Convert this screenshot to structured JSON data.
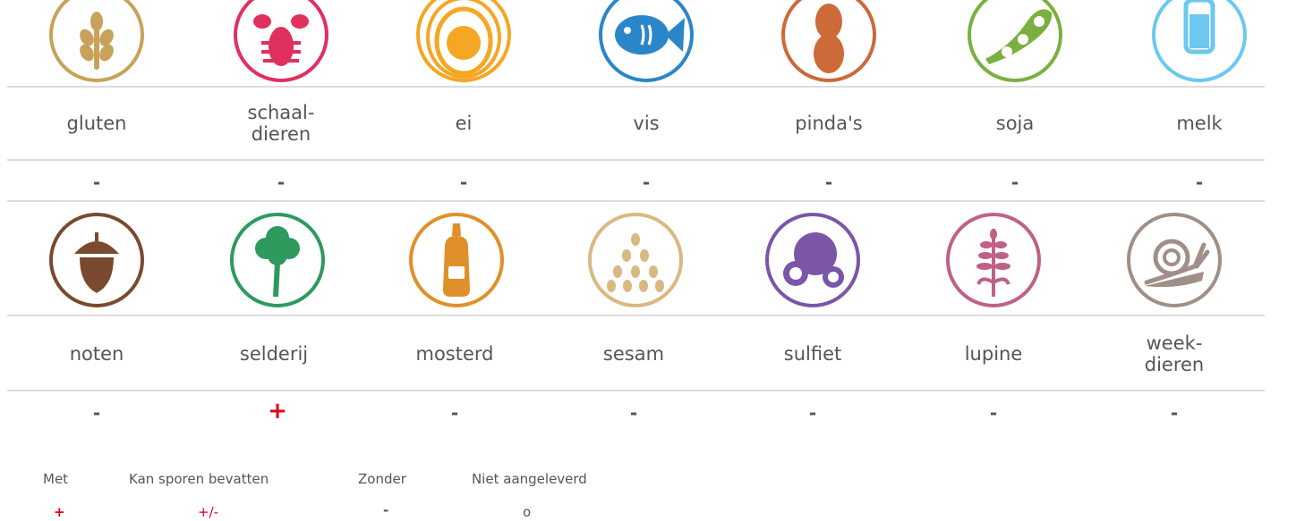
{
  "allergens_top": [
    {
      "label": "gluten",
      "value": "-",
      "color": "#c8a25a",
      "icon": "wheat-icon"
    },
    {
      "label": "schaal-\ndieren",
      "value": "-",
      "color": "#e0305e",
      "icon": "lobster-icon"
    },
    {
      "label": "ei",
      "value": "-",
      "color": "#f5a623",
      "icon": "egg-icon"
    },
    {
      "label": "vis",
      "value": "-",
      "color": "#2a86c8",
      "icon": "fish-icon"
    },
    {
      "label": "pinda's",
      "value": "-",
      "color": "#cc6a3a",
      "icon": "peanut-icon"
    },
    {
      "label": "soja",
      "value": "-",
      "color": "#7ab040",
      "icon": "soy-icon"
    },
    {
      "label": "melk",
      "value": "-",
      "color": "#6cc8f0",
      "icon": "milk-icon"
    }
  ],
  "allergens_bottom": [
    {
      "label": "noten",
      "value": "-",
      "color": "#7a4a2e",
      "icon": "acorn-icon"
    },
    {
      "label": "selderij",
      "value": "+",
      "color": "#2e9a5e",
      "icon": "celery-icon"
    },
    {
      "label": "mosterd",
      "value": "-",
      "color": "#e0902a",
      "icon": "mustard-icon"
    },
    {
      "label": "sesam",
      "value": "-",
      "color": "#d9b884",
      "icon": "sesame-icon"
    },
    {
      "label": "sulfiet",
      "value": "-",
      "color": "#7a55a8",
      "icon": "sulfite-icon"
    },
    {
      "label": "lupine",
      "value": "-",
      "color": "#c06088",
      "icon": "lupine-icon"
    },
    {
      "label": "week-\ndieren",
      "value": "-",
      "color": "#a08f86",
      "icon": "snail-icon"
    }
  ],
  "legend": {
    "met_label": "Met",
    "met_symbol": "+",
    "sporen_label": "Kan sporen bevatten",
    "sporen_symbol": "+/-",
    "zonder_label": "Zonder",
    "zonder_symbol": "-",
    "niet_label": "Niet aangeleverd",
    "niet_symbol": "o"
  }
}
